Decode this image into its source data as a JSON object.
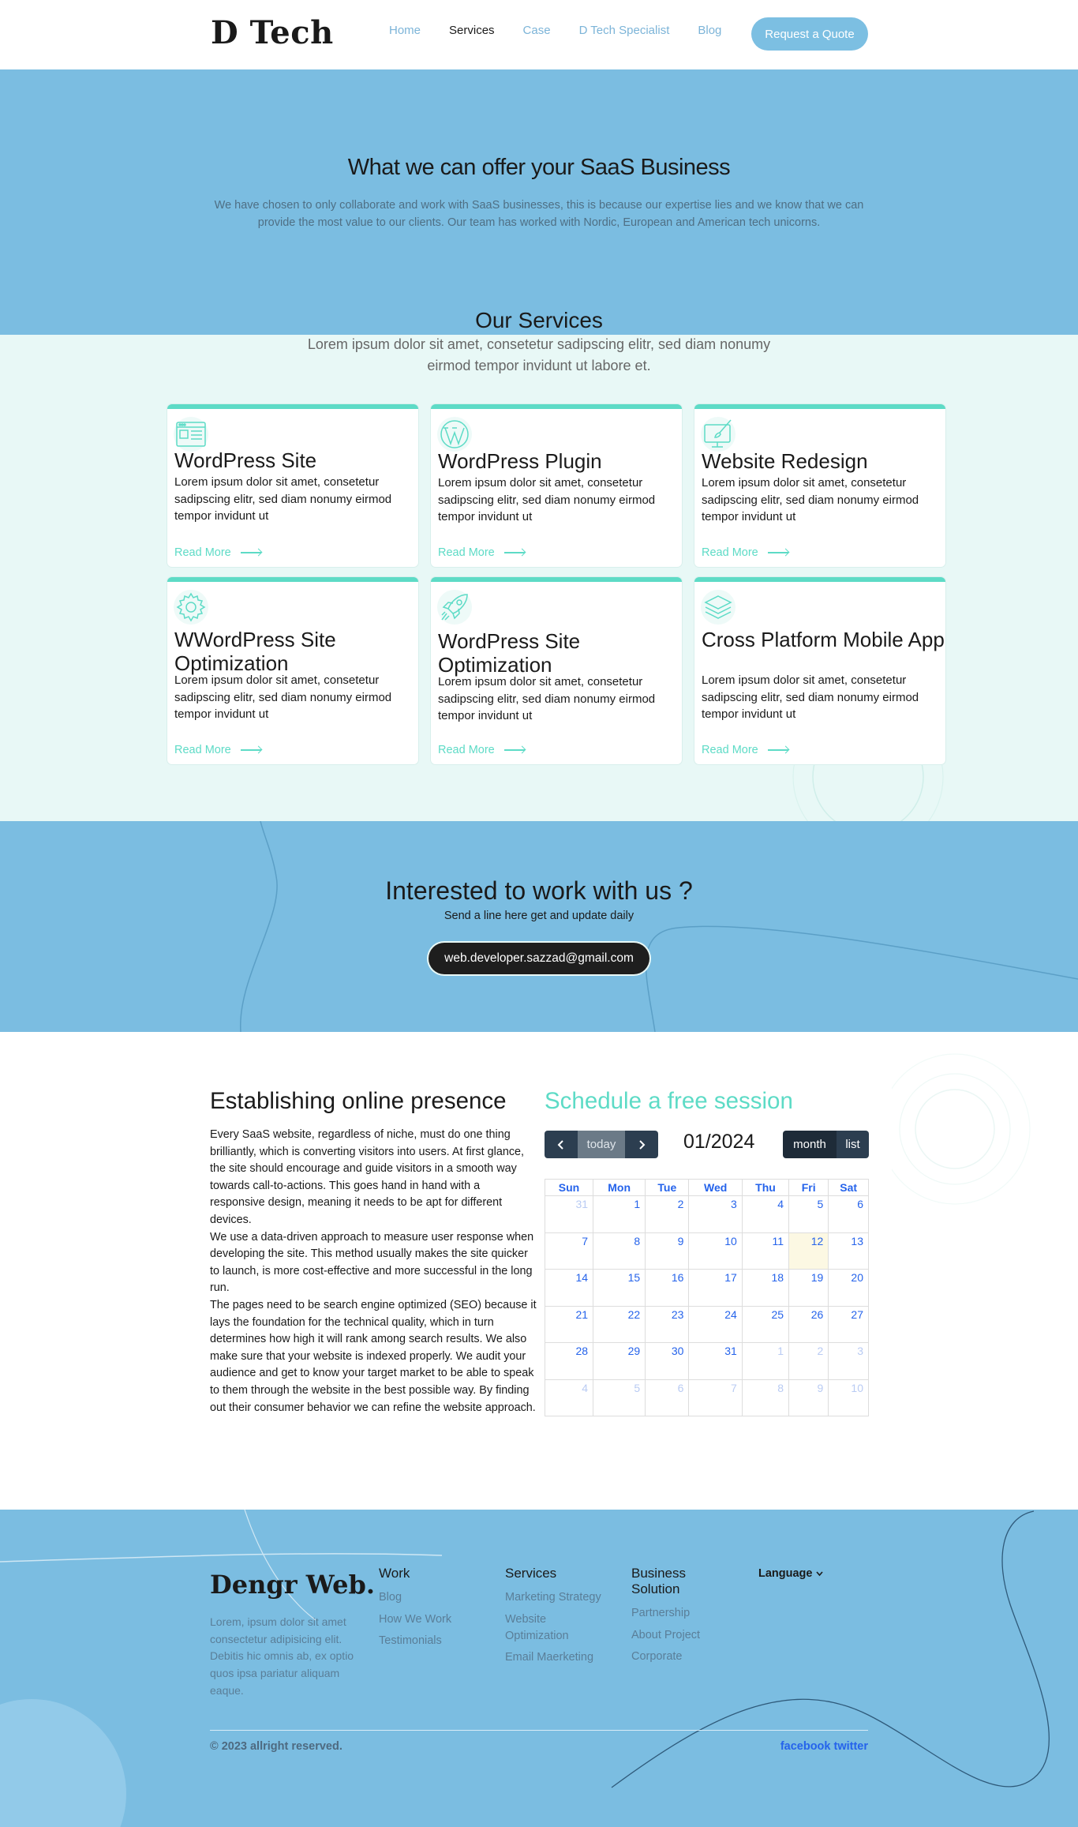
{
  "header": {
    "logo": "D Tech",
    "nav": [
      "Home",
      "Services",
      "Case",
      "D Tech Specialist",
      "Blog"
    ],
    "active_nav": "Services",
    "cta": "Request a Quote"
  },
  "hero": {
    "title": "What we can offer your SaaS Business",
    "text": "We have chosen to only collaborate and work with SaaS businesses, this is because our expertise lies and we know that we can provide the most value to our clients. Our team has worked with Nordic, European and American tech unicorns."
  },
  "services": {
    "title": "Our Services",
    "subtitle": "Lorem ipsum dolor sit amet, consetetur sadipscing elitr, sed diam nonumy eirmod tempor invidunt ut labore et.",
    "cards": [
      {
        "icon": "browser-window-icon",
        "title": "WordPress Site",
        "text": "Lorem ipsum dolor sit amet, consetetur sadipscing elitr, sed diam nonumy eirmod tempor invidunt ut",
        "link": "Read More"
      },
      {
        "icon": "wordpress-logo-icon",
        "title": "WordPress Plugin",
        "text": "Lorem ipsum dolor sit amet, consetetur sadipscing elitr, sed diam nonumy eirmod tempor invidunt ut",
        "link": "Read More"
      },
      {
        "icon": "monitor-brush-icon",
        "title": "Website Redesign",
        "text": "Lorem ipsum dolor sit amet, consetetur sadipscing elitr, sed diam nonumy eirmod tempor invidunt ut",
        "link": "Read More"
      },
      {
        "icon": "gear-icon",
        "title": "WWordPress Site Optimization",
        "text": "Lorem ipsum dolor sit amet, consetetur sadipscing elitr, sed diam nonumy eirmod tempor invidunt ut",
        "link": "Read More"
      },
      {
        "icon": "rocket-icon",
        "title": "WordPress Site Optimization",
        "text": "Lorem ipsum dolor sit amet, consetetur sadipscing elitr, sed diam nonumy eirmod tempor invidunt ut",
        "link": "Read More"
      },
      {
        "icon": "layers-icon",
        "title": "Cross Platform Mobile App",
        "text": "Lorem ipsum dolor sit amet, consetetur sadipscing elitr, sed diam nonumy eirmod tempor invidunt ut",
        "link": "Read More"
      }
    ]
  },
  "cta": {
    "title": "Interested to work with us ?",
    "subtitle": "Send a line here get and update daily",
    "email": "web.developer.sazzad@gmail.com"
  },
  "presence": {
    "title": "Establishing online presence",
    "paragraphs": [
      "Every SaaS website, regardless of niche, must do one thing brilliantly, which is converting visitors into users. At first glance, the site should encourage and guide visitors in a smooth way towards call-to-actions. This goes hand in hand with a responsive design, meaning it needs to be apt for different devices.",
      "We use a data-driven approach to measure user response when developing the site. This method usually makes the site quicker to launch, is more cost-effective and more successful in the long run.",
      "The pages need to be search engine optimized (SEO) because it lays the foundation for the technical quality, which in turn determines how high it will rank among search results. We also make sure that your website is indexed properly. We audit your audience and get to know your target market to be able to speak to them through the website in the best possible way. By finding out their consumer behavior we can refine the website approach."
    ]
  },
  "calendar": {
    "heading": "Schedule a free session",
    "today_label": "today",
    "prev_icon": "chevron-left-icon",
    "next_icon": "chevron-right-icon",
    "month_title": "01/2024",
    "view_month": "month",
    "view_list": "list",
    "days": [
      "Sun",
      "Mon",
      "Tue",
      "Wed",
      "Thu",
      "Fri",
      "Sat"
    ],
    "weeks": [
      [
        {
          "d": "31",
          "o": true
        },
        {
          "d": "1"
        },
        {
          "d": "2"
        },
        {
          "d": "3"
        },
        {
          "d": "4"
        },
        {
          "d": "5"
        },
        {
          "d": "6"
        }
      ],
      [
        {
          "d": "7"
        },
        {
          "d": "8"
        },
        {
          "d": "9"
        },
        {
          "d": "10"
        },
        {
          "d": "11"
        },
        {
          "d": "12",
          "t": true
        },
        {
          "d": "13"
        }
      ],
      [
        {
          "d": "14"
        },
        {
          "d": "15"
        },
        {
          "d": "16"
        },
        {
          "d": "17"
        },
        {
          "d": "18"
        },
        {
          "d": "19"
        },
        {
          "d": "20"
        }
      ],
      [
        {
          "d": "21"
        },
        {
          "d": "22"
        },
        {
          "d": "23"
        },
        {
          "d": "24"
        },
        {
          "d": "25"
        },
        {
          "d": "26"
        },
        {
          "d": "27"
        }
      ],
      [
        {
          "d": "28"
        },
        {
          "d": "29"
        },
        {
          "d": "30"
        },
        {
          "d": "31"
        },
        {
          "d": "1",
          "o": true
        },
        {
          "d": "2",
          "o": true
        },
        {
          "d": "3",
          "o": true
        }
      ],
      [
        {
          "d": "4",
          "o": true
        },
        {
          "d": "5",
          "o": true
        },
        {
          "d": "6",
          "o": true
        },
        {
          "d": "7",
          "o": true
        },
        {
          "d": "8",
          "o": true
        },
        {
          "d": "9",
          "o": true
        },
        {
          "d": "10",
          "o": true
        }
      ]
    ]
  },
  "footer": {
    "logo": "Dengr Web.",
    "about": "Lorem, ipsum dolor sit amet consectetur adipisicing elit. Debitis hic omnis ab, ex optio quos ipsa pariatur aliquam eaque.",
    "columns": [
      {
        "title": "Work",
        "links": [
          "Blog",
          "How We Work",
          "Testimonials"
        ]
      },
      {
        "title": "Services",
        "links": [
          "Marketing Strategy",
          "Website Optimization",
          "Email Maerketing"
        ]
      },
      {
        "title": "Business Solution",
        "links": [
          "Partnership",
          "About Project",
          "Corporate"
        ]
      }
    ],
    "language": "Language",
    "copyright": "© 2023 allright reserved.",
    "social": "facebook twitter"
  }
}
